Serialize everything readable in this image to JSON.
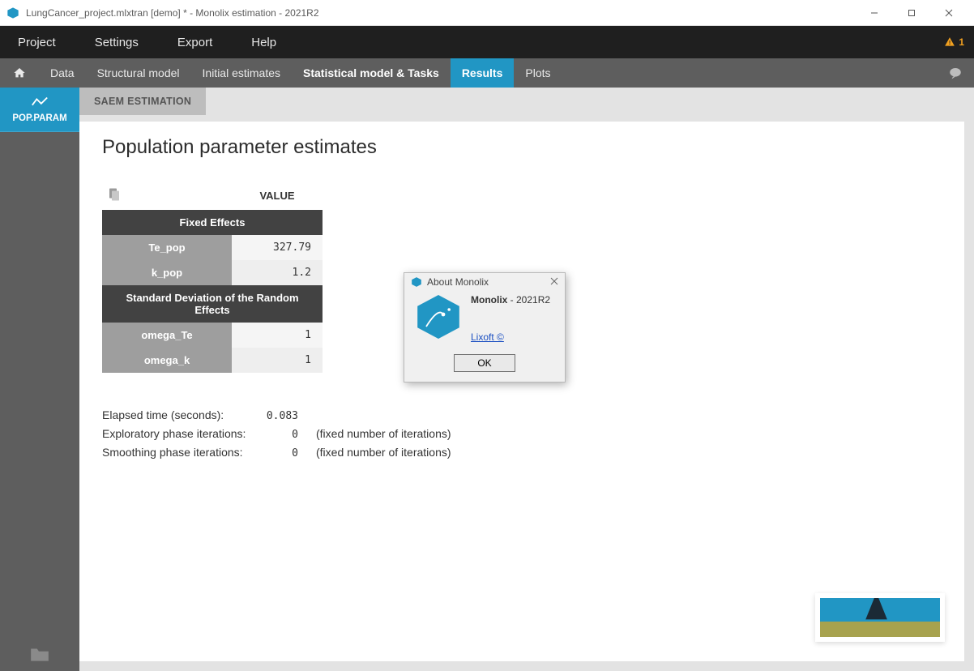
{
  "window": {
    "title": "LungCancer_project.mlxtran [demo] * - Monolix estimation - 2021R2"
  },
  "menubar": {
    "items": [
      "Project",
      "Settings",
      "Export",
      "Help"
    ],
    "warning_count": "1"
  },
  "tabs": {
    "items": [
      "Data",
      "Structural model",
      "Initial estimates",
      "Statistical model & Tasks",
      "Results",
      "Plots"
    ],
    "bold_index": 3,
    "active_index": 4
  },
  "sidebar": {
    "items": [
      {
        "label": "POP.PARAM"
      }
    ]
  },
  "subtabs": {
    "items": [
      "SAEM ESTIMATION"
    ]
  },
  "page": {
    "title": "Population parameter estimates",
    "value_header": "VALUE"
  },
  "table": {
    "sections": [
      {
        "title": "Fixed Effects",
        "rows": [
          {
            "name": "Te_pop",
            "value": "327.79"
          },
          {
            "name": "k_pop",
            "value": "1.2"
          }
        ]
      },
      {
        "title": "Standard Deviation of the Random Effects",
        "rows": [
          {
            "name": "omega_Te",
            "value": "1"
          },
          {
            "name": "omega_k",
            "value": "1"
          }
        ]
      }
    ]
  },
  "stats": {
    "elapsed_label": "Elapsed time (seconds):",
    "elapsed_value": "0.083",
    "exploratory_label": "Exploratory phase iterations:",
    "exploratory_value": "0",
    "exploratory_note": "(fixed number of iterations)",
    "smoothing_label": "Smoothing phase iterations:",
    "smoothing_value": "0",
    "smoothing_note": "(fixed number of iterations)"
  },
  "dialog": {
    "title": "About Monolix",
    "product": "Monolix",
    "dash": " - ",
    "version": "2021R2",
    "link_text": "Lixoft ©",
    "ok_label": "OK"
  }
}
